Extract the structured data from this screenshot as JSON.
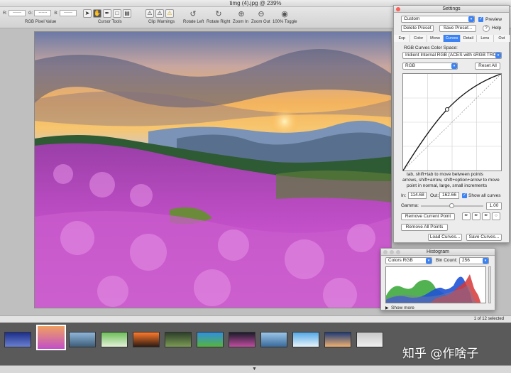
{
  "window": {
    "title": "timg (4).jpg @ 239%"
  },
  "toolbar": {
    "pixel": {
      "r_label": "R:",
      "g_label": "G:",
      "b_label": "B:",
      "r_value": "------",
      "g_value": "------",
      "b_value": "------",
      "label": "RGB Pixel Value"
    },
    "cursor_tools_label": "Cursor Tools",
    "clip_warnings_label": "Clip Warnings",
    "rotate_left": "Rotate Left",
    "rotate_right": "Rotate Right",
    "zoom_in": "Zoom In",
    "zoom_out": "Zoom Out",
    "toggle_100": "100% Toggle"
  },
  "status": {
    "selection": "1 of 12 selected"
  },
  "filmstrip": {
    "selected_index": 1,
    "thumbs": [
      {
        "c1": "#1d2f8a",
        "c2": "#6a7fd0"
      },
      {
        "c1": "#f0a060",
        "c2": "#c24fc8"
      },
      {
        "c1": "#8fb6d9",
        "c2": "#3e5e7a"
      },
      {
        "c1": "#6dbf5a",
        "c2": "#e4f2d8"
      },
      {
        "c1": "#ff7a2a",
        "c2": "#2b1a14"
      },
      {
        "c1": "#2c3e2a",
        "c2": "#7c9a54"
      },
      {
        "c1": "#2f8fe0",
        "c2": "#56b43c"
      },
      {
        "c1": "#1b1b2a",
        "c2": "#c04da0"
      },
      {
        "c1": "#9cc6e8",
        "c2": "#3a6a9a"
      },
      {
        "c1": "#54a9e6",
        "c2": "#e8f4fa"
      },
      {
        "c1": "#1f3c78",
        "c2": "#f0b070"
      },
      {
        "c1": "#c8c8c8",
        "c2": "#f0f0f0"
      }
    ]
  },
  "settings": {
    "title": "Settings",
    "preset_value": "Custom",
    "preview_label": "Preview",
    "delete_preset": "Delete Preset",
    "save_preset": "Save Preset...",
    "help_label": "Help",
    "help_icon": "?",
    "tabs": [
      "Exp",
      "Color",
      "Mono",
      "Curves",
      "Detail",
      "Lens",
      "Out"
    ],
    "active_tab": "Curves",
    "colorspace_label": "RGB Curves Color Space:",
    "colorspace_value": "Iridient Internal RGB (ACES with sRGB TRC)",
    "channel_value": "RGB",
    "reset_all": "Reset All",
    "help_text": [
      "tab, shift+tab to move between points",
      "arrows, shift+arrow, shift+option+arrow to move",
      "point in normal, large, small increments"
    ],
    "in_label": "In:",
    "in_value": "114.68",
    "out_label": "Out:",
    "out_value": "162.66",
    "show_all_curves": "Show all curves",
    "gamma_label": "Gamma:",
    "gamma_value": "1.00",
    "remove_current_point": "Remove Current Point",
    "remove_all_points": "Remove All Points",
    "load_curves": "Load Curves...",
    "save_curves": "Save Curves..."
  },
  "histogram": {
    "title": "Histogram",
    "mode_value": "Colors RGB",
    "bin_count_label": "Bin Count:",
    "bin_count_value": "256",
    "show_more": "Show more"
  },
  "watermark": {
    "text": "知乎 @作啥子"
  },
  "colors": {
    "accent": "#3b82f6",
    "close": "#fc5f57",
    "minimize": "#fdbc2e",
    "zoom": "#28c840"
  }
}
